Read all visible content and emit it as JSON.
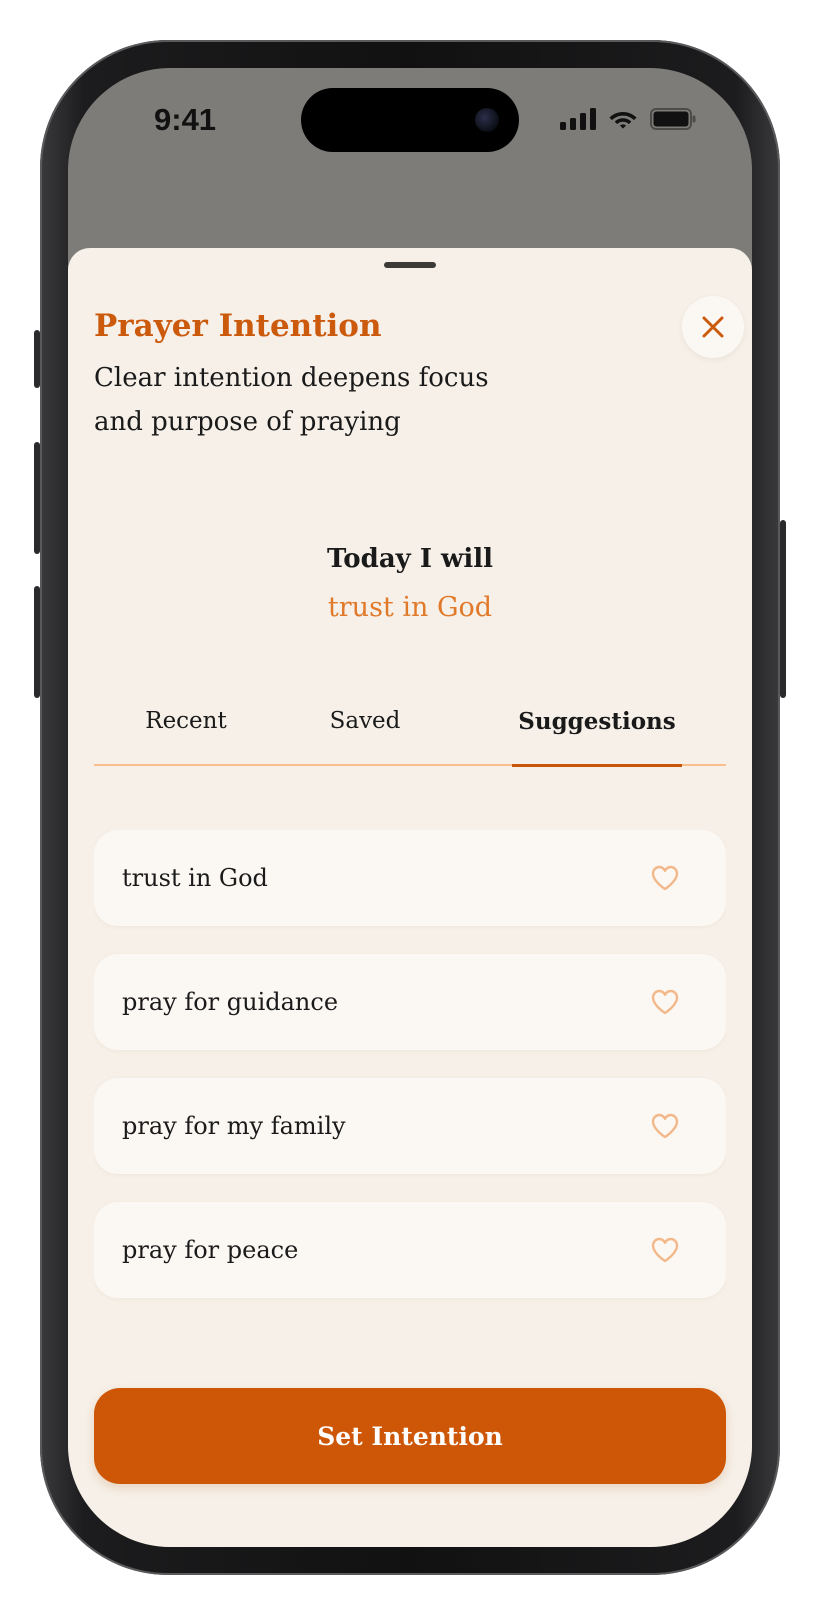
{
  "status_bar": {
    "time": "9:41"
  },
  "sheet": {
    "title": "Prayer Intention",
    "subtitle": "Clear intention deepens focus and purpose of praying",
    "close_icon": "close-icon"
  },
  "today": {
    "label": "Today I will",
    "value": "trust in God"
  },
  "tabs": [
    {
      "label": "Recent",
      "active": false
    },
    {
      "label": "Saved",
      "active": false
    },
    {
      "label": "Suggestions",
      "active": true
    }
  ],
  "suggestions": [
    {
      "text": "trust in God",
      "icon": "heart-outline-icon"
    },
    {
      "text": "pray for guidance",
      "icon": "heart-outline-icon"
    },
    {
      "text": "pray for my family",
      "icon": "heart-outline-icon"
    },
    {
      "text": "pray for peace",
      "icon": "heart-outline-icon"
    }
  ],
  "cta": {
    "label": "Set Intention"
  },
  "colors": {
    "accent": "#cd5706",
    "accent_text": "#cc5a0c",
    "highlight": "#e07a2a",
    "sheet_bg": "#f6f0e8",
    "card_bg": "#fbf8f3",
    "tab_line": "#f7c08e",
    "heart": "#f3b88a"
  }
}
